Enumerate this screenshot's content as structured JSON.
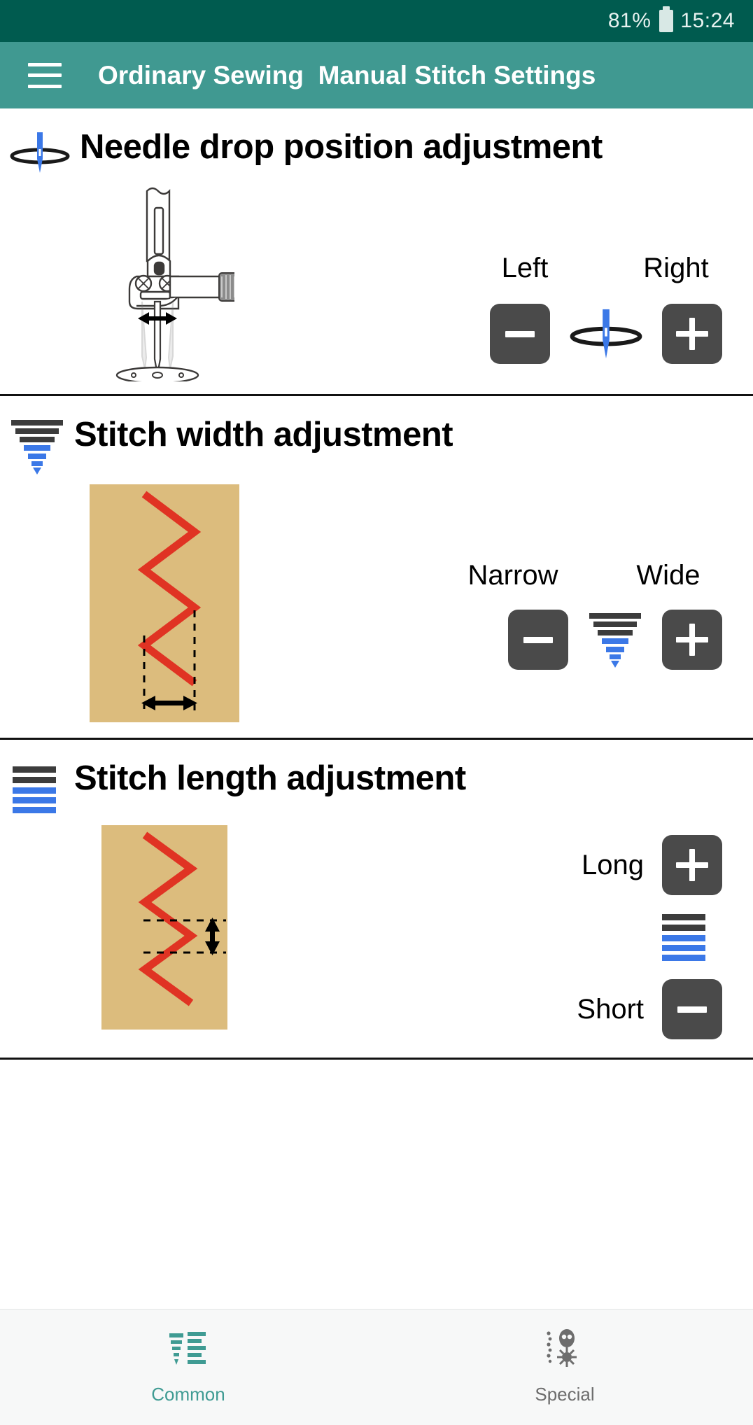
{
  "statusbar": {
    "battery_percent": "81%",
    "time": "15:24",
    "battery_icon": "battery-icon",
    "bg_color": "#005b4f"
  },
  "appbar": {
    "menu_icon": "hamburger-menu-icon",
    "title": "Ordinary Sewing  Manual Stitch Settings",
    "bg_color": "#409991"
  },
  "sections": [
    {
      "id": "needle-drop-position",
      "icon": "needle-drop-icon",
      "title": "Needle drop position adjustment",
      "illustration": "needle-clamp-diagram",
      "left_label": "Left",
      "right_label": "Right",
      "decrement_label": "−",
      "increment_label": "+",
      "center_icon": "needle-drop-icon"
    },
    {
      "id": "stitch-width",
      "icon": "stitch-width-funnel-icon",
      "title": "Stitch width adjustment",
      "illustration": "zigzag-width-diagram",
      "left_label": "Narrow",
      "right_label": "Wide",
      "decrement_label": "−",
      "increment_label": "+",
      "center_icon": "stitch-width-funnel-icon"
    },
    {
      "id": "stitch-length",
      "icon": "stitch-length-bars-icon",
      "title": "Stitch length adjustment",
      "illustration": "zigzag-length-diagram",
      "long_label": "Long",
      "short_label": "Short",
      "increment_label": "+",
      "decrement_label": "−",
      "center_icon": "stitch-length-bars-icon"
    }
  ],
  "tabbar": {
    "tabs": [
      {
        "id": "common",
        "label": "Common",
        "icon": "common-stitches-icon",
        "active": true,
        "color": "#3f9b93"
      },
      {
        "id": "special",
        "label": "Special",
        "icon": "special-stitches-icon",
        "active": false,
        "color": "#6d6d6d"
      }
    ]
  },
  "colors": {
    "accent": "#409991",
    "statusbar": "#005b4f",
    "button": "#4a4a4a",
    "fabric": "#dcbc7d",
    "thread": "#e03323",
    "needle_blue": "#3b78e7"
  }
}
